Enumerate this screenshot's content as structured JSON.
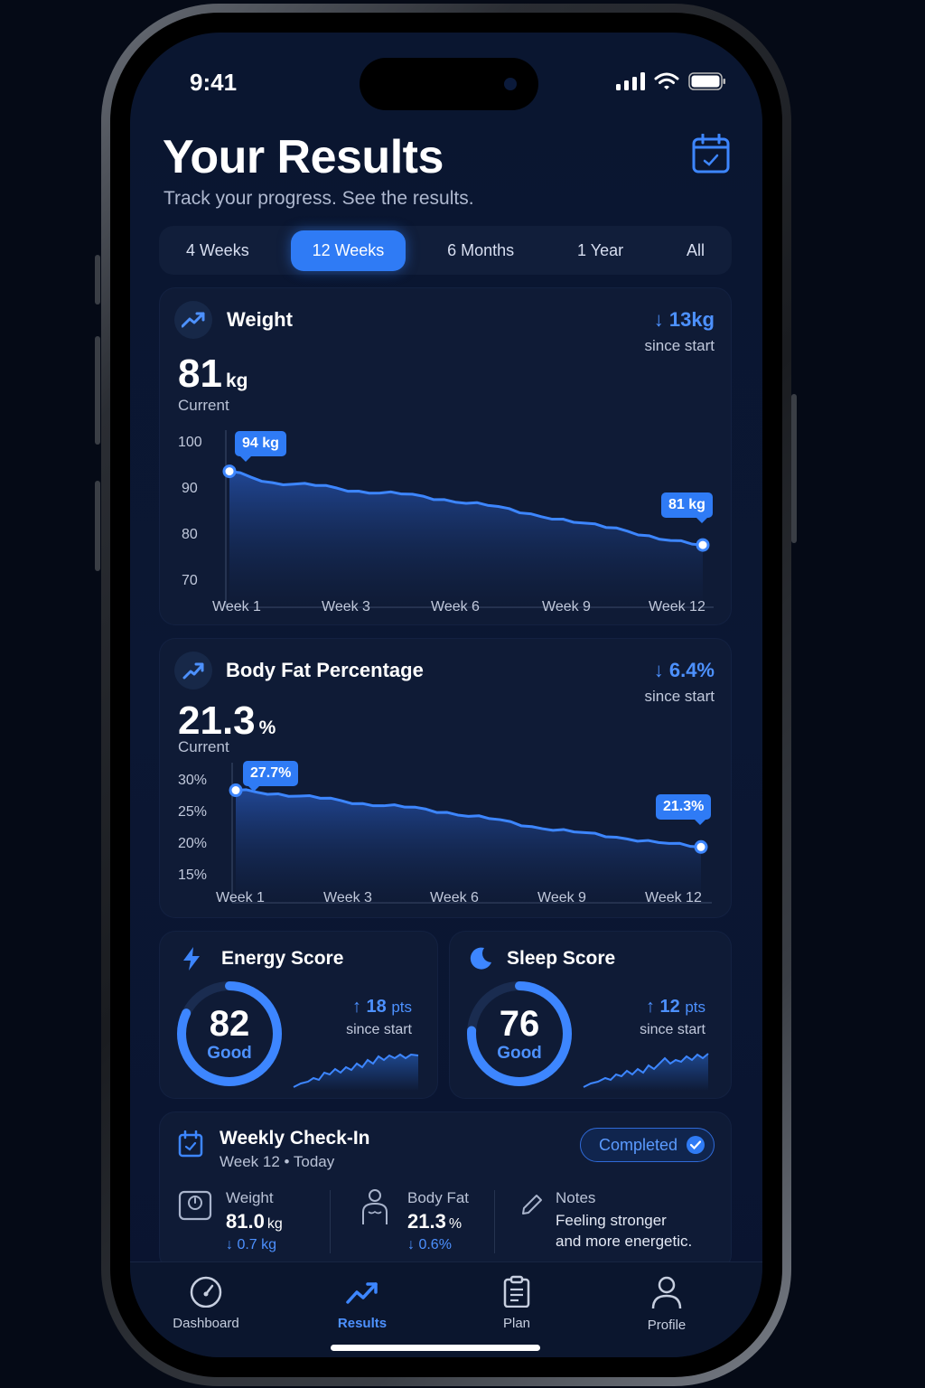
{
  "status": {
    "time": "9:41"
  },
  "header": {
    "title": "Your Results",
    "subtitle": "Track your progress. See the results."
  },
  "ranges": [
    "4 Weeks",
    "12 Weeks",
    "6 Months",
    "1 Year",
    "All"
  ],
  "selected_range": "12 Weeks",
  "weight": {
    "title": "Weight",
    "delta": "13kg",
    "delta_caption": "since start",
    "value": "81",
    "unit": "kg",
    "value_caption": "Current",
    "y_ticks": [
      "100",
      "90",
      "80",
      "70"
    ],
    "x_ticks": [
      "Week 1",
      "Week 3",
      "Week 6",
      "Week 9",
      "Week 12"
    ],
    "start_label": "94 kg",
    "end_label": "81 kg"
  },
  "body_fat": {
    "title": "Body Fat Percentage",
    "delta": "6.4%",
    "delta_caption": "since start",
    "value": "21.3",
    "unit": "%",
    "value_caption": "Current",
    "y_ticks": [
      "30%",
      "25%",
      "20%",
      "15%"
    ],
    "x_ticks": [
      "Week 1",
      "Week 3",
      "Week 6",
      "Week 9",
      "Week 12"
    ],
    "start_label": "27.7%",
    "end_label": "21.3%"
  },
  "chart_data": [
    {
      "type": "area",
      "x": [
        "Week 1",
        "Week 2",
        "Week 3",
        "Week 4",
        "Week 5",
        "Week 6",
        "Week 7",
        "Week 8",
        "Week 9",
        "Week 10",
        "Week 11",
        "Week 12"
      ],
      "values": [
        94,
        92,
        91.5,
        90.5,
        90,
        89,
        88,
        86.5,
        85,
        84,
        82,
        81
      ],
      "ylim": [
        70,
        100
      ],
      "grid": false
    },
    {
      "type": "area",
      "x": [
        "Week 1",
        "Week 2",
        "Week 3",
        "Week 4",
        "Week 5",
        "Week 6",
        "Week 7",
        "Week 8",
        "Week 9",
        "Week 10",
        "Week 11",
        "Week 12"
      ],
      "values": [
        27.7,
        27.3,
        26.8,
        26.2,
        25.8,
        25.2,
        24.5,
        23.6,
        23.0,
        22.4,
        21.8,
        21.3
      ],
      "ylim": [
        15,
        30
      ],
      "grid": false
    }
  ],
  "energy": {
    "title": "Energy Score",
    "score": "82",
    "score_pct": 82,
    "label": "Good",
    "delta": "18",
    "delta_unit": "pts",
    "caption": "since start"
  },
  "sleep": {
    "title": "Sleep Score",
    "score": "76",
    "score_pct": 76,
    "label": "Good",
    "delta": "12",
    "delta_unit": "pts",
    "caption": "since start"
  },
  "checkin": {
    "title": "Weekly Check-In",
    "subtitle": "Week 12 • Today",
    "status": "Completed",
    "weight_label": "Weight",
    "weight_value": "81.0",
    "weight_unit": "kg",
    "weight_delta": "0.7 kg",
    "fat_label": "Body Fat",
    "fat_value": "21.3",
    "fat_unit": "%",
    "fat_delta": "0.6%",
    "notes_label": "Notes",
    "notes_line1": "Feeling stronger",
    "notes_line2": "and more energetic."
  },
  "tabs": [
    {
      "label": "Dashboard",
      "icon": "gauge-icon"
    },
    {
      "label": "Results",
      "icon": "trend-icon"
    },
    {
      "label": "Plan",
      "icon": "clipboard-icon"
    },
    {
      "label": "Profile",
      "icon": "user-icon"
    }
  ],
  "colors": {
    "accent": "#2f7bf5",
    "accent_text": "#4d91ff",
    "background": "#0a1630",
    "card": "#0f1b36"
  }
}
